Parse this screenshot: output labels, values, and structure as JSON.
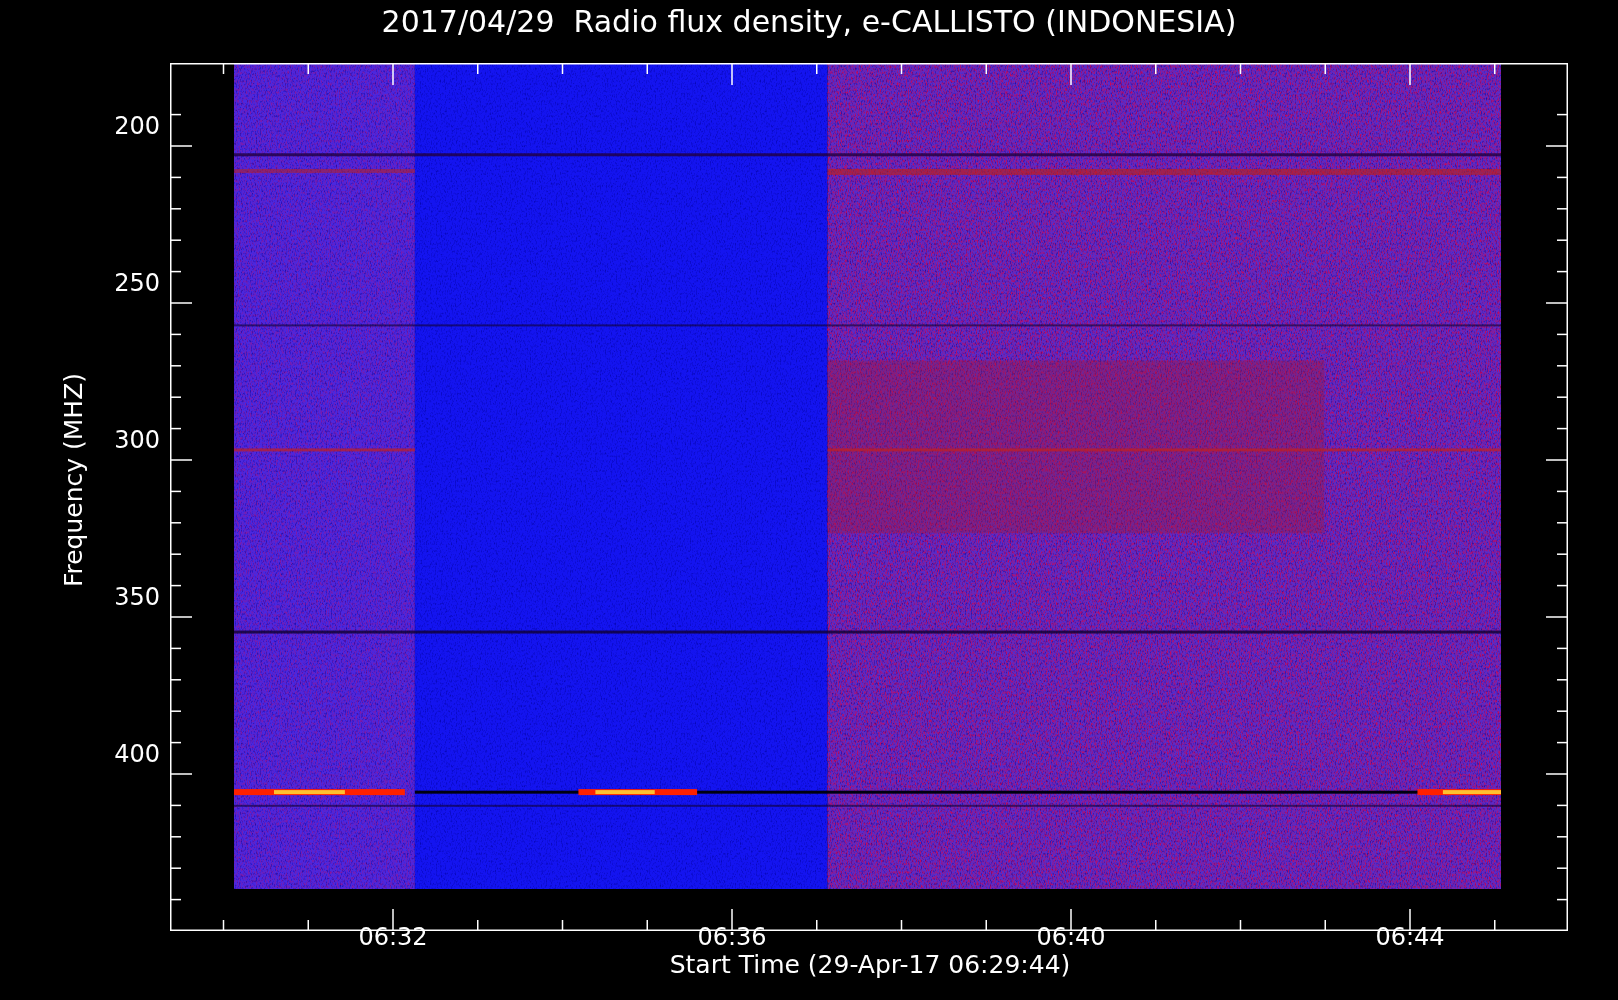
{
  "title": "2017/04/29  Radio flux density, e-CALLISTO (INDONESIA)",
  "plot": {
    "ylabel": "Frequency (MHZ)",
    "xlabel": "Start Time (29-Apr-17 06:29:44)",
    "yticks": [
      "200",
      "250",
      "300",
      "350",
      "400"
    ],
    "xticks": [
      "06:32",
      "06:36",
      "06:40",
      "06:44"
    ]
  }
}
